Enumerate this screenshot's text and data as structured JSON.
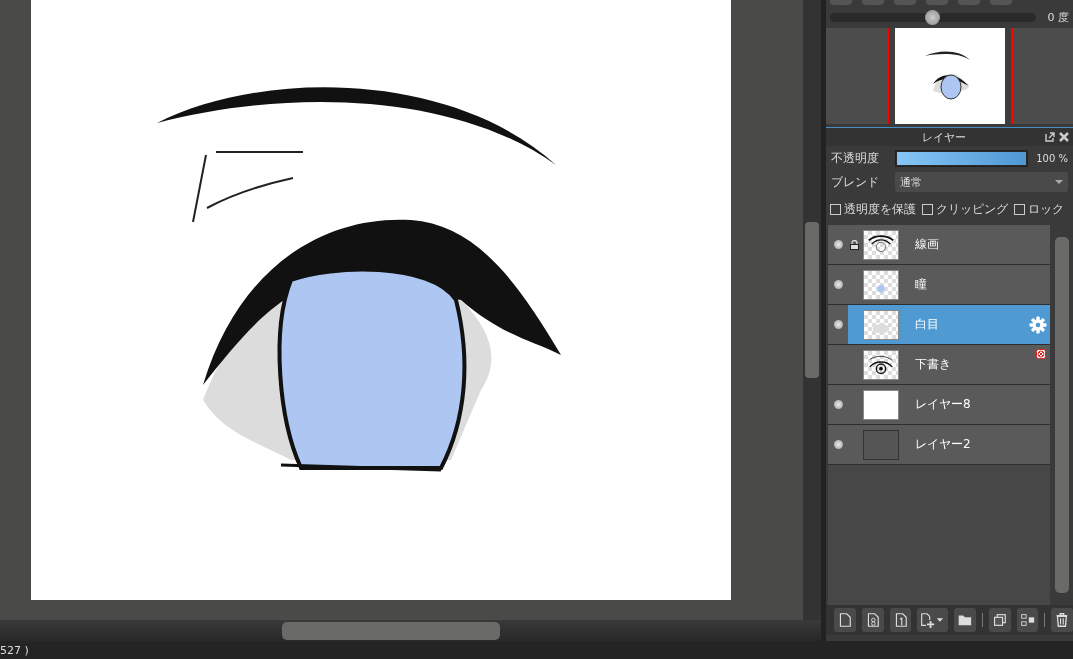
{
  "navigator": {
    "rotation": {
      "level": 0.5,
      "reading": "0 度"
    }
  },
  "layer_panel": {
    "title": "レイヤー",
    "opacity": {
      "label": "不透明度",
      "level": 1,
      "reading": "100 %"
    },
    "blend": {
      "label": "ブレンド",
      "value": "通常"
    },
    "options": [
      {
        "label": "透明度を保護",
        "checked": false
      },
      {
        "label": "クリッピング",
        "checked": false
      },
      {
        "label": "ロック",
        "checked": false
      }
    ],
    "layers": [
      {
        "name": "線画",
        "visible": true,
        "locked": true,
        "selected": false,
        "error": false,
        "kind": "lineart"
      },
      {
        "name": "瞳",
        "visible": true,
        "locked": false,
        "selected": false,
        "error": false,
        "kind": "dot"
      },
      {
        "name": "白目",
        "visible": true,
        "locked": false,
        "selected": true,
        "error": false,
        "kind": "shape"
      },
      {
        "name": "下書き",
        "visible": false,
        "locked": false,
        "selected": false,
        "error": true,
        "kind": "sketch"
      },
      {
        "name": "レイヤー8",
        "visible": true,
        "locked": false,
        "selected": false,
        "error": false,
        "kind": "white"
      },
      {
        "name": "レイヤー2",
        "visible": true,
        "locked": false,
        "selected": false,
        "error": false,
        "kind": "empty"
      }
    ]
  },
  "status_bar": {
    "text": "527 )"
  }
}
